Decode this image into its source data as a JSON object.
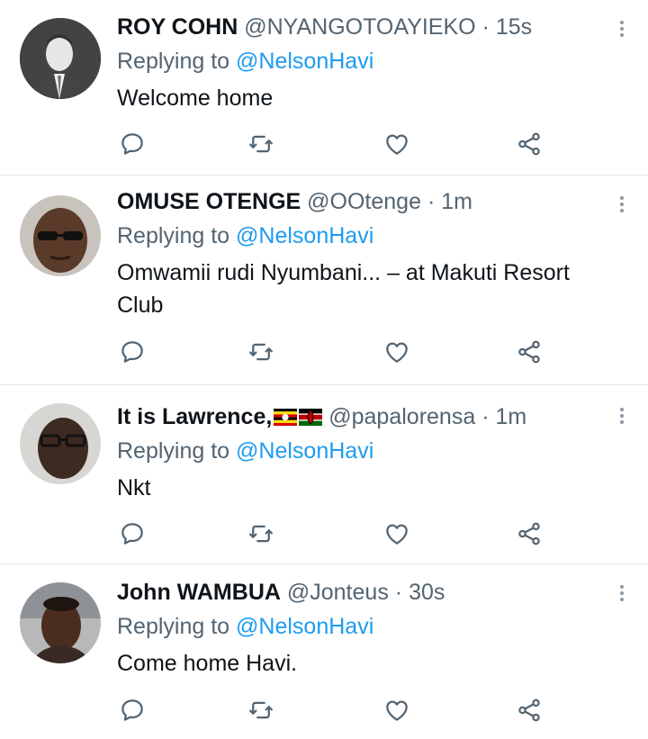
{
  "tweets": [
    {
      "name": "ROY COHN",
      "handle": "@NYANGOTOAYIEKO",
      "time": "15s",
      "reply_prefix": "Replying to",
      "reply_to": "@NelsonHavi",
      "text": "Welcome home",
      "avatar_desc": "grayscale-portrait"
    },
    {
      "name": "OMUSE OTENGE",
      "handle": "@OOtenge",
      "time": "1m",
      "reply_prefix": "Replying to",
      "reply_to": "@NelsonHavi",
      "text": "Omwamii rudi Nyumbani... – at Makuti Resort Club",
      "avatar_desc": "portrait-sunglasses"
    },
    {
      "name": "It is Lawrence,",
      "handle": "@papalorensa",
      "time": "1m",
      "reply_prefix": "Replying to",
      "reply_to": "@NelsonHavi",
      "text": "Nkt",
      "avatar_desc": "portrait-glasses",
      "name_emoji": [
        "uganda-flag",
        "kenya-flag"
      ]
    },
    {
      "name": "John WAMBUA",
      "handle": "@Jonteus",
      "time": "30s",
      "reply_prefix": "Replying to",
      "reply_to": "@NelsonHavi",
      "text": "Come home Havi.",
      "avatar_desc": "portrait"
    }
  ],
  "separator": "·",
  "colors": {
    "link": "#1d9bf0",
    "muted": "#536471",
    "icon": "#536471"
  },
  "action_icons": [
    "reply-icon",
    "retweet-icon",
    "like-icon",
    "share-icon"
  ]
}
